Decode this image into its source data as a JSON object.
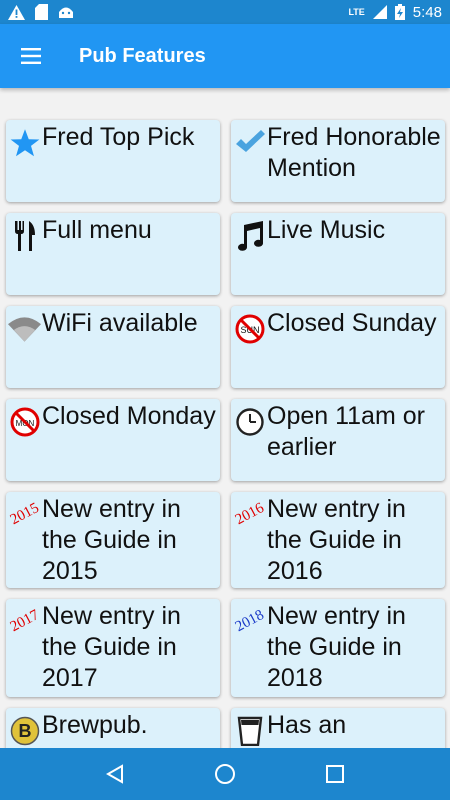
{
  "status_bar": {
    "time": "5:48",
    "network": "LTE"
  },
  "app_bar": {
    "title": "Pub Features"
  },
  "features": [
    {
      "label": "Fred Top Pick",
      "icon": "star-icon"
    },
    {
      "label": "Fred Honorable Mention",
      "icon": "checkmark-icon"
    },
    {
      "label": "Full menu",
      "icon": "fork-knife-icon"
    },
    {
      "label": "Live Music",
      "icon": "music-note-icon"
    },
    {
      "label": "WiFi available",
      "icon": "wifi-icon"
    },
    {
      "label": "Closed Sunday",
      "icon": "closed-sunday-icon",
      "icon_text": "SUN"
    },
    {
      "label": "Closed Monday",
      "icon": "closed-monday-icon",
      "icon_text": "MON"
    },
    {
      "label": "Open 11am or earlier",
      "icon": "clock-icon"
    },
    {
      "label": "New entry in the Guide in 2015",
      "icon": "year-2015-icon",
      "icon_text": "2015"
    },
    {
      "label": "New entry in the Guide in 2016",
      "icon": "year-2016-icon",
      "icon_text": "2016"
    },
    {
      "label": "New entry in the Guide in 2017",
      "icon": "year-2017-icon",
      "icon_text": "2017"
    },
    {
      "label": "New entry in the Guide in 2018",
      "icon": "year-2018-icon",
      "icon_text": "2018"
    },
    {
      "label": "Brewpub.",
      "icon": "brewpub-icon",
      "icon_text": "B"
    },
    {
      "label": "Has an",
      "icon": "glass-icon"
    }
  ],
  "colors": {
    "app_bar": "#2196f3",
    "status_bar": "#1d86ce",
    "card": "#dcf1fb",
    "icon_blue": "#2196f3",
    "year_red": "#e00000",
    "year_blue": "#1a3ac8"
  }
}
